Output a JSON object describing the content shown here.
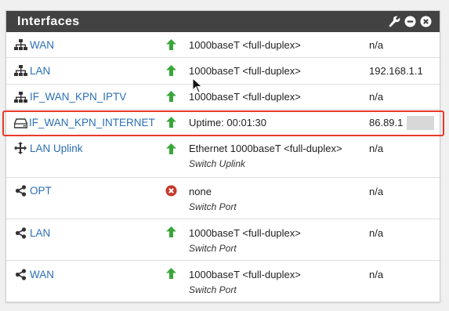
{
  "panel": {
    "title": "Interfaces"
  },
  "heading_icons": [
    "wrench-icon",
    "minus-circle-icon",
    "close-circle-icon"
  ],
  "colors": {
    "header_bg": "#424242",
    "link": "#2a6fb5",
    "status_up": "#3aa63a",
    "status_down": "#c7382c",
    "highlight": "#ea3a2a"
  },
  "rows": [
    {
      "icon": "network-icon",
      "name": "WAN",
      "status": "up",
      "media": "1000baseT <full-duplex>",
      "sub": "",
      "ip": "n/a"
    },
    {
      "icon": "network-icon",
      "name": "LAN",
      "status": "up",
      "media": "1000baseT <full-duplex>",
      "sub": "",
      "ip": "192.168.1.1"
    },
    {
      "icon": "network-icon",
      "name": "IF_WAN_KPN_IPTV",
      "status": "up",
      "media": "1000baseT <full-duplex>",
      "sub": "",
      "ip": "n/a"
    },
    {
      "icon": "hard-drive-icon",
      "name": "IF_WAN_KPN_INTERNET",
      "status": "up",
      "media": "Uptime: 00:01:30",
      "sub": "",
      "ip": "86.89.1"
    },
    {
      "icon": "arrows-move-icon",
      "name": "LAN Uplink",
      "status": "up",
      "media": "Ethernet 1000baseT <full-duplex>",
      "sub": "Switch Uplink",
      "ip": "n/a"
    },
    {
      "icon": "share-icon",
      "name": "OPT",
      "status": "down",
      "media": "none",
      "sub": "Switch Port",
      "ip": "n/a"
    },
    {
      "icon": "share-icon",
      "name": "LAN",
      "status": "up",
      "media": "1000baseT <full-duplex>",
      "sub": "Switch Port",
      "ip": "n/a"
    },
    {
      "icon": "share-icon",
      "name": "WAN",
      "status": "up",
      "media": "1000baseT <full-duplex>",
      "sub": "Switch Port",
      "ip": "n/a"
    }
  ]
}
